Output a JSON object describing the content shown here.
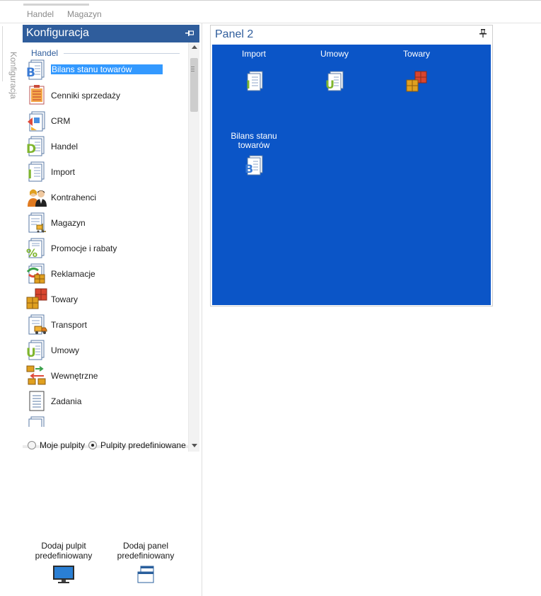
{
  "top_tabs": [
    "Handel",
    "Magazyn"
  ],
  "side_tab_label": "Konfiguracja",
  "left_panel": {
    "title": "Konfiguracja",
    "group": "Handel",
    "items": [
      {
        "label": "Bilans stanu towarów",
        "icon": "document-b-icon",
        "selected": true
      },
      {
        "label": "Cenniki sprzedaży",
        "icon": "price-list-icon"
      },
      {
        "label": "CRM",
        "icon": "crm-icon"
      },
      {
        "label": "Handel",
        "icon": "document-d-icon"
      },
      {
        "label": "Import",
        "icon": "document-i-icon"
      },
      {
        "label": "Kontrahenci",
        "icon": "contractors-icon"
      },
      {
        "label": "Magazyn",
        "icon": "warehouse-icon"
      },
      {
        "label": "Promocje i rabaty",
        "icon": "discount-icon"
      },
      {
        "label": "Reklamacje",
        "icon": "complaints-icon"
      },
      {
        "label": "Towary",
        "icon": "goods-icon"
      },
      {
        "label": "Transport",
        "icon": "transport-icon"
      },
      {
        "label": "Umowy",
        "icon": "document-u-icon"
      },
      {
        "label": "Wewnętrzne",
        "icon": "internal-icon"
      },
      {
        "label": "Zadania",
        "icon": "tasks-icon"
      }
    ],
    "radio_options": [
      {
        "label": "Moje pulpity",
        "checked": false
      },
      {
        "label": "Pulpity predefiniowane",
        "checked": true
      }
    ],
    "buttons": [
      {
        "line1": "Dodaj pulpit",
        "line2": "predefiniowany",
        "icon": "monitor-icon"
      },
      {
        "line1": "Dodaj panel",
        "line2": "predefiniowany",
        "icon": "window-panel-icon"
      }
    ]
  },
  "panel2": {
    "title": "Panel 2",
    "tiles": [
      {
        "label": "Import",
        "icon": "document-i-icon"
      },
      {
        "label": "Umowy",
        "icon": "document-u-icon"
      },
      {
        "label": "Towary",
        "icon": "goods-icon"
      },
      {
        "line1": "Bilans stanu",
        "line2": "towarów",
        "icon": "document-b-icon"
      }
    ]
  },
  "colors": {
    "header_blue": "#2f5d9c",
    "panel_blue": "#0b55c7",
    "selection": "#3399ff"
  }
}
